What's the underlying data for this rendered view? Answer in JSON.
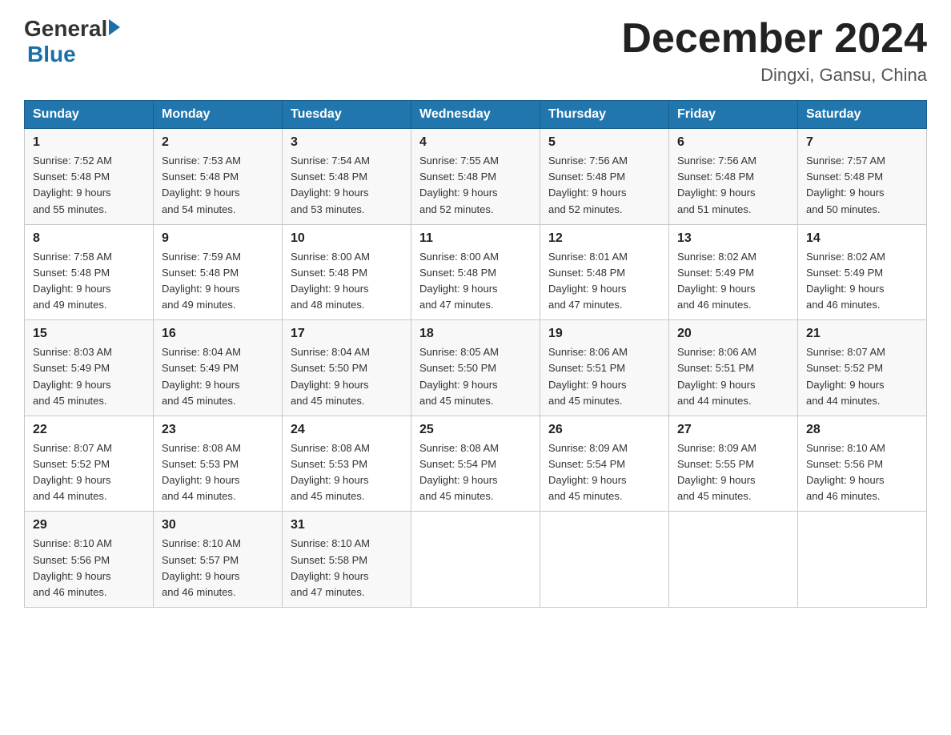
{
  "header": {
    "logo_general": "General",
    "logo_blue": "Blue",
    "title": "December 2024",
    "subtitle": "Dingxi, Gansu, China"
  },
  "days_of_week": [
    "Sunday",
    "Monday",
    "Tuesday",
    "Wednesday",
    "Thursday",
    "Friday",
    "Saturday"
  ],
  "weeks": [
    [
      {
        "day": "1",
        "sunrise": "7:52 AM",
        "sunset": "5:48 PM",
        "daylight": "9 hours and 55 minutes."
      },
      {
        "day": "2",
        "sunrise": "7:53 AM",
        "sunset": "5:48 PM",
        "daylight": "9 hours and 54 minutes."
      },
      {
        "day": "3",
        "sunrise": "7:54 AM",
        "sunset": "5:48 PM",
        "daylight": "9 hours and 53 minutes."
      },
      {
        "day": "4",
        "sunrise": "7:55 AM",
        "sunset": "5:48 PM",
        "daylight": "9 hours and 52 minutes."
      },
      {
        "day": "5",
        "sunrise": "7:56 AM",
        "sunset": "5:48 PM",
        "daylight": "9 hours and 52 minutes."
      },
      {
        "day": "6",
        "sunrise": "7:56 AM",
        "sunset": "5:48 PM",
        "daylight": "9 hours and 51 minutes."
      },
      {
        "day": "7",
        "sunrise": "7:57 AM",
        "sunset": "5:48 PM",
        "daylight": "9 hours and 50 minutes."
      }
    ],
    [
      {
        "day": "8",
        "sunrise": "7:58 AM",
        "sunset": "5:48 PM",
        "daylight": "9 hours and 49 minutes."
      },
      {
        "day": "9",
        "sunrise": "7:59 AM",
        "sunset": "5:48 PM",
        "daylight": "9 hours and 49 minutes."
      },
      {
        "day": "10",
        "sunrise": "8:00 AM",
        "sunset": "5:48 PM",
        "daylight": "9 hours and 48 minutes."
      },
      {
        "day": "11",
        "sunrise": "8:00 AM",
        "sunset": "5:48 PM",
        "daylight": "9 hours and 47 minutes."
      },
      {
        "day": "12",
        "sunrise": "8:01 AM",
        "sunset": "5:48 PM",
        "daylight": "9 hours and 47 minutes."
      },
      {
        "day": "13",
        "sunrise": "8:02 AM",
        "sunset": "5:49 PM",
        "daylight": "9 hours and 46 minutes."
      },
      {
        "day": "14",
        "sunrise": "8:02 AM",
        "sunset": "5:49 PM",
        "daylight": "9 hours and 46 minutes."
      }
    ],
    [
      {
        "day": "15",
        "sunrise": "8:03 AM",
        "sunset": "5:49 PM",
        "daylight": "9 hours and 45 minutes."
      },
      {
        "day": "16",
        "sunrise": "8:04 AM",
        "sunset": "5:49 PM",
        "daylight": "9 hours and 45 minutes."
      },
      {
        "day": "17",
        "sunrise": "8:04 AM",
        "sunset": "5:50 PM",
        "daylight": "9 hours and 45 minutes."
      },
      {
        "day": "18",
        "sunrise": "8:05 AM",
        "sunset": "5:50 PM",
        "daylight": "9 hours and 45 minutes."
      },
      {
        "day": "19",
        "sunrise": "8:06 AM",
        "sunset": "5:51 PM",
        "daylight": "9 hours and 45 minutes."
      },
      {
        "day": "20",
        "sunrise": "8:06 AM",
        "sunset": "5:51 PM",
        "daylight": "9 hours and 44 minutes."
      },
      {
        "day": "21",
        "sunrise": "8:07 AM",
        "sunset": "5:52 PM",
        "daylight": "9 hours and 44 minutes."
      }
    ],
    [
      {
        "day": "22",
        "sunrise": "8:07 AM",
        "sunset": "5:52 PM",
        "daylight": "9 hours and 44 minutes."
      },
      {
        "day": "23",
        "sunrise": "8:08 AM",
        "sunset": "5:53 PM",
        "daylight": "9 hours and 44 minutes."
      },
      {
        "day": "24",
        "sunrise": "8:08 AM",
        "sunset": "5:53 PM",
        "daylight": "9 hours and 45 minutes."
      },
      {
        "day": "25",
        "sunrise": "8:08 AM",
        "sunset": "5:54 PM",
        "daylight": "9 hours and 45 minutes."
      },
      {
        "day": "26",
        "sunrise": "8:09 AM",
        "sunset": "5:54 PM",
        "daylight": "9 hours and 45 minutes."
      },
      {
        "day": "27",
        "sunrise": "8:09 AM",
        "sunset": "5:55 PM",
        "daylight": "9 hours and 45 minutes."
      },
      {
        "day": "28",
        "sunrise": "8:10 AM",
        "sunset": "5:56 PM",
        "daylight": "9 hours and 46 minutes."
      }
    ],
    [
      {
        "day": "29",
        "sunrise": "8:10 AM",
        "sunset": "5:56 PM",
        "daylight": "9 hours and 46 minutes."
      },
      {
        "day": "30",
        "sunrise": "8:10 AM",
        "sunset": "5:57 PM",
        "daylight": "9 hours and 46 minutes."
      },
      {
        "day": "31",
        "sunrise": "8:10 AM",
        "sunset": "5:58 PM",
        "daylight": "9 hours and 47 minutes."
      },
      null,
      null,
      null,
      null
    ]
  ],
  "labels": {
    "sunrise": "Sunrise:",
    "sunset": "Sunset:",
    "daylight": "Daylight:"
  }
}
